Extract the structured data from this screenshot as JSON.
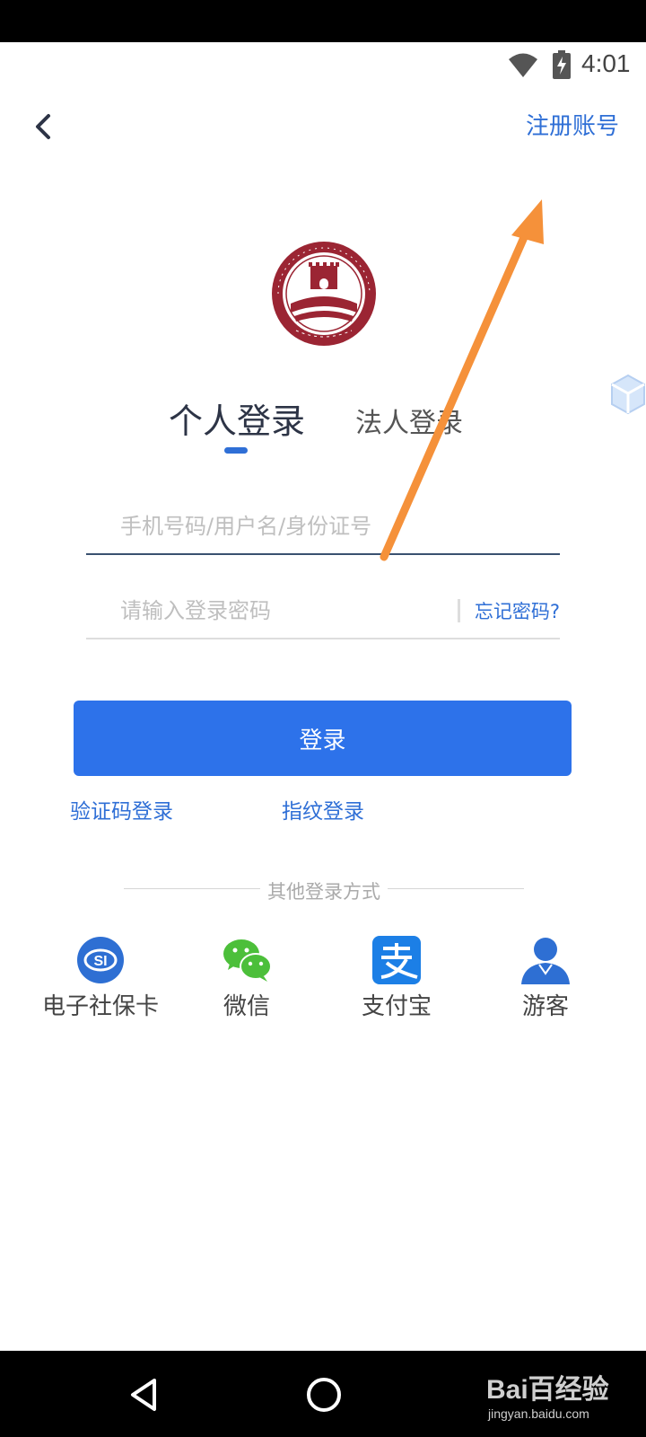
{
  "status_bar": {
    "time": "4:01"
  },
  "nav": {
    "register_label": "注册账号"
  },
  "logo": {
    "seal_text": "Hebei Government Services",
    "seal_bottom_text": "河北政务服务"
  },
  "tabs": {
    "personal": "个人登录",
    "legal": "法人登录"
  },
  "username": {
    "placeholder": "手机号码/用户名/身份证号"
  },
  "password": {
    "placeholder": "请输入登录密码",
    "forgot_label": "忘记密码?"
  },
  "login_button": {
    "label": "登录"
  },
  "alt_logins": {
    "sms": "验证码登录",
    "fingerprint": "指纹登录"
  },
  "other_methods": {
    "title": "其他登录方式",
    "items": [
      {
        "label": "电子社保卡",
        "icon": "social-security-card-icon"
      },
      {
        "label": "微信",
        "icon": "wechat-icon"
      },
      {
        "label": "支付宝",
        "icon": "alipay-icon"
      },
      {
        "label": "游客",
        "icon": "guest-icon"
      }
    ]
  },
  "watermark": {
    "brand": "Bai百经验",
    "url": "jingyan.baidu.com"
  },
  "colors": {
    "accent": "#2d72ea",
    "link": "#2f6fd6",
    "logo": "#9b2533",
    "arrow": "#f5913a"
  }
}
